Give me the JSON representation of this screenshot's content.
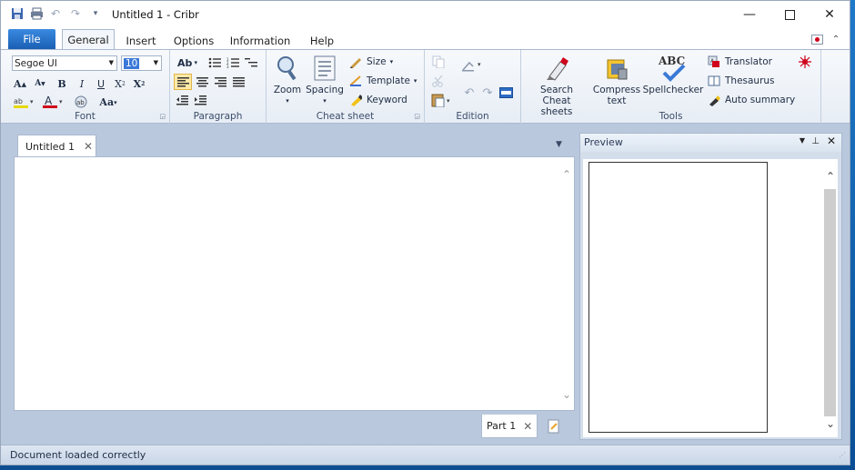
{
  "window": {
    "title": "Untitled 1 - Cribr",
    "qa_icons": [
      "save-icon",
      "print-icon",
      "undo-icon",
      "redo-icon",
      "customize-icon"
    ],
    "controls": [
      "minimize",
      "maximize",
      "close"
    ]
  },
  "tabs": {
    "file": "File",
    "items": [
      "General",
      "Insert",
      "Options",
      "Information",
      "Help"
    ],
    "active": "General"
  },
  "ribbon": {
    "font": {
      "label": "Font",
      "font_name": "Segoe UI",
      "font_size": "10",
      "grow": "A",
      "shrink": "A",
      "bold": "B",
      "italic": "I",
      "underline": "U",
      "subscript": "X",
      "superscript": "X",
      "change_case": "Aa"
    },
    "paragraph": {
      "label": "Paragraph",
      "styles": "Ab"
    },
    "cheatsheet": {
      "label": "Cheat sheet",
      "zoom": "Zoom",
      "spacing": "Spacing",
      "size": "Size",
      "template": "Template",
      "keyword": "Keyword"
    },
    "edition": {
      "label": "Edition"
    },
    "tools": {
      "label": "Tools",
      "search_line1": "Search",
      "search_line2": "Cheat sheets",
      "compress_line1": "Compress",
      "compress_line2": "text",
      "spellchecker": "Spellchecker",
      "spell_badge": "ABC",
      "translator": "Translator",
      "thesaurus": "Thesaurus",
      "auto_summary": "Auto summary"
    }
  },
  "document": {
    "tab": "Untitled 1",
    "part_tab": "Part 1"
  },
  "preview": {
    "title": "Preview"
  },
  "status": {
    "text": "Document loaded correctly"
  },
  "colors": {
    "file_tab": "#1a5fb4",
    "accent_selected": "#fde9a8",
    "workspace": "#b9c8dc",
    "font_color_bar": "#d0021b",
    "highlight_bar": "#e8d800"
  }
}
